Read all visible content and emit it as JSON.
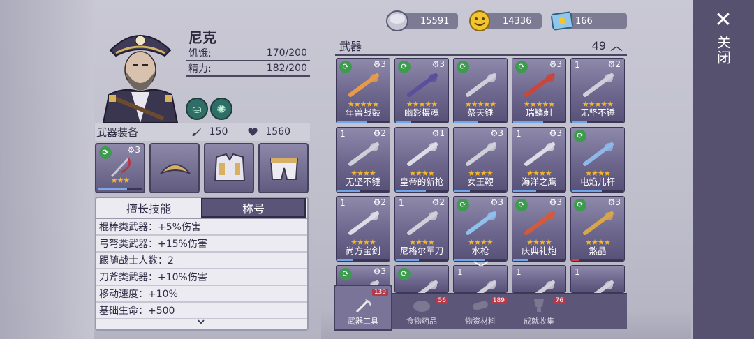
{
  "colors": {
    "panel": "#56516f",
    "accent_star": "#f6b72b",
    "tile": "#6d678e"
  },
  "close": {
    "label": "关闭",
    "icon": "close-icon"
  },
  "character": {
    "name": "尼克",
    "hunger_label": "饥饿:",
    "hunger_value": "170/200",
    "energy_label": "精力:",
    "energy_value": "182/200"
  },
  "equipment": {
    "title": "武器装备",
    "attack": "150",
    "health": "1560",
    "slot1_level": "3",
    "slot1_stars": "★★★"
  },
  "skills": {
    "tabs": [
      "擅长技能",
      "称号"
    ],
    "rows": [
      "棍棒类武器：+5%伤害",
      "弓弩类武器：+15%伤害",
      "跟随战士人数：2",
      "刀斧类武器：+10%伤害",
      "移动速度：+10%",
      "基础生命：+500"
    ]
  },
  "currency": {
    "silver": "15591",
    "gold": "14336",
    "tickets": "166"
  },
  "weapons": {
    "title": "武器",
    "count": "49",
    "items": [
      {
        "name": "年兽战鼓",
        "level": "",
        "gear": "3",
        "stars": "★★★★★"
      },
      {
        "name": "幽影摄魂",
        "level": "",
        "gear": "3",
        "stars": "★★★★★"
      },
      {
        "name": "祭天锤",
        "level": "",
        "gear": "",
        "stars": "★★★★★"
      },
      {
        "name": "瑞鳞刺",
        "level": "",
        "gear": "3",
        "stars": "★★★★★"
      },
      {
        "name": "无坚不锤",
        "level": "1",
        "gear": "2",
        "stars": "★★★★★"
      },
      {
        "name": "无坚不锤",
        "level": "1",
        "gear": "2",
        "stars": "★★★★"
      },
      {
        "name": "皇帝的新枪",
        "level": "",
        "gear": "1",
        "stars": "★★★★"
      },
      {
        "name": "女王鞭",
        "level": "",
        "gear": "3",
        "stars": "★★★★"
      },
      {
        "name": "海洋之鹰",
        "level": "1",
        "gear": "3",
        "stars": "★★★★"
      },
      {
        "name": "电焰儿杆",
        "level": "",
        "gear": "",
        "stars": "★★★★"
      },
      {
        "name": "尚方宝剑",
        "level": "1",
        "gear": "2",
        "stars": "★★★★"
      },
      {
        "name": "尼格尔军刀",
        "level": "1",
        "gear": "2",
        "stars": "★★★★"
      },
      {
        "name": "水枪",
        "level": "",
        "gear": "3",
        "stars": "★★★★"
      },
      {
        "name": "庆典礼炮",
        "level": "",
        "gear": "3",
        "stars": "★★★★"
      },
      {
        "name": "煞晶",
        "level": "",
        "gear": "3",
        "stars": "★★★★"
      },
      {
        "name": "",
        "level": "",
        "gear": "3",
        "stars": ""
      },
      {
        "name": "",
        "level": "",
        "gear": "",
        "stars": ""
      },
      {
        "name": "",
        "level": "1",
        "gear": "",
        "stars": ""
      },
      {
        "name": "",
        "level": "1",
        "gear": "",
        "stars": ""
      },
      {
        "name": "",
        "level": "1",
        "gear": "",
        "stars": ""
      }
    ]
  },
  "tabs": [
    {
      "label": "武器工具",
      "count": "139"
    },
    {
      "label": "食物药品",
      "count": "56"
    },
    {
      "label": "物资材料",
      "count": "189"
    },
    {
      "label": "成就收集",
      "count": "76"
    }
  ]
}
